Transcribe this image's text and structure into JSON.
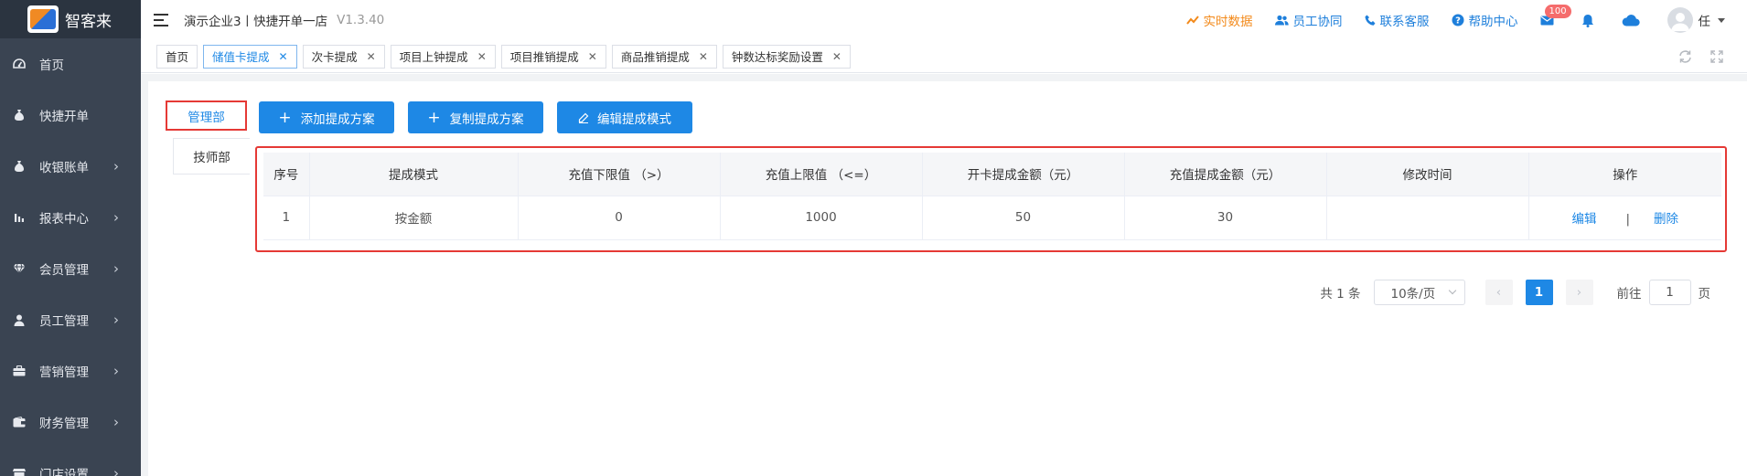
{
  "brand": {
    "name": "智客来",
    "logo_text": "智客来"
  },
  "sidebar": {
    "items": [
      {
        "label": "首页",
        "icon": "dashboard-icon",
        "chevron": false
      },
      {
        "label": "快捷开单",
        "icon": "money-bag-icon",
        "chevron": false
      },
      {
        "label": "收银账单",
        "icon": "money-bag-icon",
        "chevron": true
      },
      {
        "label": "报表中心",
        "icon": "bar-chart-icon",
        "chevron": true
      },
      {
        "label": "会员管理",
        "icon": "diamond-icon",
        "chevron": true
      },
      {
        "label": "员工管理",
        "icon": "user-icon",
        "chevron": true
      },
      {
        "label": "营销管理",
        "icon": "briefcase-icon",
        "chevron": true
      },
      {
        "label": "财务管理",
        "icon": "wallet-icon",
        "chevron": true
      },
      {
        "label": "门店设置",
        "icon": "store-icon",
        "chevron": true
      }
    ]
  },
  "header": {
    "title": "演示企业3丨快捷开单一店",
    "version": "V1.3.40",
    "links": {
      "realtime": "实时数据",
      "collab": "员工协同",
      "support": "联系客服",
      "help": "帮助中心"
    },
    "mail_badge": "100",
    "user_name": "任"
  },
  "tabs": [
    {
      "label": "首页",
      "closable": false,
      "active": false
    },
    {
      "label": "储值卡提成",
      "closable": true,
      "active": true
    },
    {
      "label": "次卡提成",
      "closable": true,
      "active": false
    },
    {
      "label": "项目上钟提成",
      "closable": true,
      "active": false
    },
    {
      "label": "项目推销提成",
      "closable": true,
      "active": false
    },
    {
      "label": "商品推销提成",
      "closable": true,
      "active": false
    },
    {
      "label": "钟数达标奖励设置",
      "closable": true,
      "active": false
    }
  ],
  "departments": [
    "管理部",
    "技师部"
  ],
  "actions": {
    "add": "添加提成方案",
    "copy": "复制提成方案",
    "edit": "编辑提成模式"
  },
  "table": {
    "headers": [
      "序号",
      "提成模式",
      "充值下限值 （>）",
      "充值上限值 （<=）",
      "开卡提成金额（元）",
      "充值提成金额（元）",
      "修改时间",
      "操作"
    ],
    "rows": [
      {
        "index": "1",
        "mode": "按金额",
        "min": "0",
        "max": "1000",
        "open_amount": "50",
        "recharge_amount": "30",
        "modified": "",
        "op_edit": "编辑",
        "op_sep": "|",
        "op_delete": "删除"
      }
    ]
  },
  "pagination": {
    "total": "共 1 条",
    "page_size": "10条/页",
    "current": "1",
    "goto_prefix": "前往",
    "goto_value": "1",
    "goto_suffix": "页"
  },
  "colors": {
    "sidebar_bg": "#3a4452",
    "primary": "#1e88e5",
    "highlight_border": "#e53935",
    "orange_link": "#f38a1b"
  }
}
